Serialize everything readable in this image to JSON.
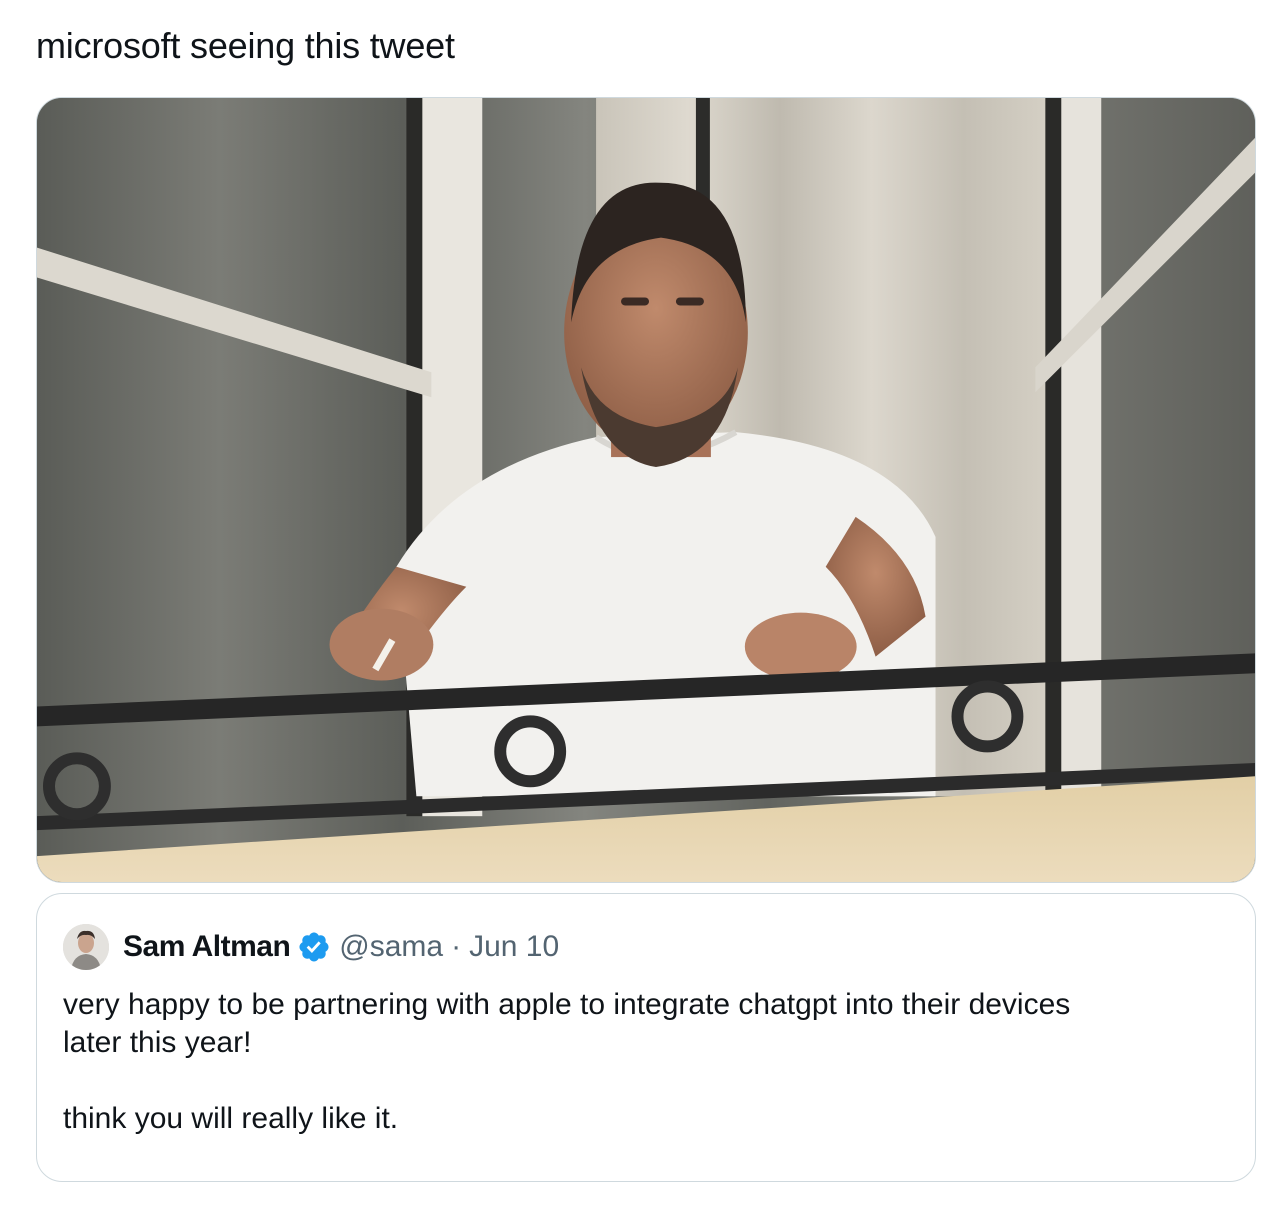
{
  "post": {
    "text": "microsoft seeing this tweet"
  },
  "media": {
    "icon": "photo-of-man-smoking-on-balcony"
  },
  "quoted_tweet": {
    "display_name": "Sam Altman",
    "handle": "@sama",
    "separator": "·",
    "date": "Jun 10",
    "verified": true,
    "body": "very happy to be partnering with apple to integrate chatgpt into their devices\nlater this year!\n\nthink you will really like it."
  },
  "colors": {
    "text": "#0f1419",
    "secondary_text": "#536471",
    "border": "#cfd9de",
    "verified_badge": "#1d9bf0"
  }
}
